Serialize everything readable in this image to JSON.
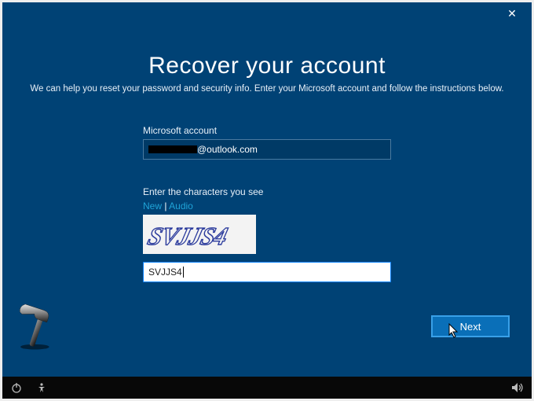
{
  "titlebar": {
    "close_glyph": "✕"
  },
  "page": {
    "title": "Recover your account",
    "subtitle": "We can help you reset your password and security info. Enter your Microsoft account and follow the instructions below."
  },
  "account": {
    "label": "Microsoft account",
    "email_suffix": "@outlook.com"
  },
  "captcha": {
    "label": "Enter the characters you see",
    "link_new": "New",
    "link_sep": " | ",
    "link_audio": "Audio",
    "image_text": "SVJJS4",
    "input_value": "SVJJS4"
  },
  "buttons": {
    "next": "Next"
  }
}
